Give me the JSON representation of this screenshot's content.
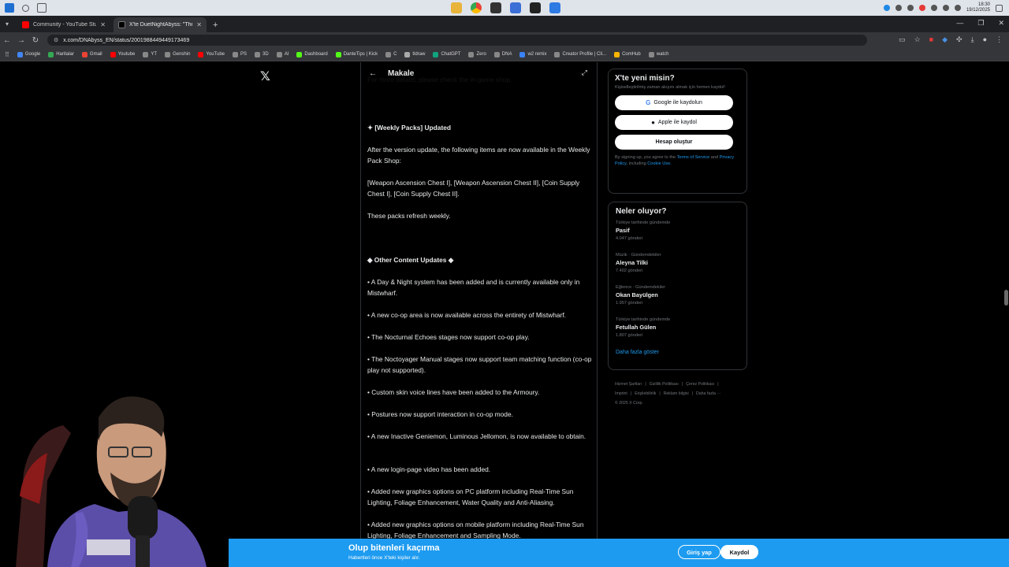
{
  "taskbar": {
    "clock_time": "18:30",
    "clock_date": "19/12/2025"
  },
  "browser": {
    "tabs": [
      {
        "title": "Community - YouTube Studio",
        "active": false,
        "color": "#ff0000"
      },
      {
        "title": "X'te DuetNightAbyss: \"The Wi",
        "active": true,
        "color": "#000000"
      }
    ],
    "url": "x.com/DNAbyss_EN/status/2001988449449173469",
    "bookmarks": [
      "Google",
      "Haritalar",
      "Gmail",
      "Youtube",
      "YT",
      "Genshin",
      "YouTube",
      "PS",
      "3D",
      "AI",
      "Dashboard",
      "DanteTips | Kick",
      "C",
      "tldraw",
      "ChatGPT",
      "Zero",
      "DNA",
      "w2 remix",
      "Creator Profile | Cli...",
      "ComHub",
      "watch"
    ]
  },
  "article": {
    "header_title": "Makale",
    "paragraphs": [
      {
        "text": "For more details, please check the in-game shop.",
        "bold": false
      },
      {
        "text": "✦ [Weekly Packs] Updated",
        "bold": true
      },
      {
        "text": "After the version update, the following items are now available in the Weekly Pack Shop:",
        "bold": false
      },
      {
        "text": "[Weapon Ascension Chest I], [Weapon Ascension Chest II], [Coin Supply Chest I], [Coin Supply Chest II].",
        "bold": false
      },
      {
        "text": "These packs refresh weekly.",
        "bold": false
      },
      {
        "text": "◆ Other Content Updates ◆",
        "bold": true
      },
      {
        "text": "• A Day & Night system has been added and is currently available only in Mistwharf.",
        "bold": false
      },
      {
        "text": "• A new co-op area is now available across the entirety of Mistwharf.",
        "bold": false
      },
      {
        "text": "• The Nocturnal Echoes stages now support co-op play.",
        "bold": false
      },
      {
        "text": "• The Noctoyager Manual stages now support team matching function (co-op play not supported).",
        "bold": false
      },
      {
        "text": "• Custom skin voice lines have been added to the Armoury.",
        "bold": false
      },
      {
        "text": "• Postures now support interaction in co-op mode.",
        "bold": false
      },
      {
        "text": "• A new Inactive Geniemon, Luminous Jellomon, is now available to obtain.",
        "bold": false
      },
      {
        "text": "• A new login-page video has been added.",
        "bold": false
      },
      {
        "text": "• Added new graphics options on PC platform including Real-Time Sun Lighting, Foliage Enhancement, Water Quality and Anti-Aliasing.",
        "bold": false
      },
      {
        "text": "• Added new graphics options on mobile platform including Real-Time Sun Lighting, Foliage Enhancement and Sampling Mode.",
        "bold": false
      }
    ]
  },
  "signup": {
    "title": "X'te yeni misin?",
    "subtitle": "Kişiselleştirilmiş zaman akışını almak için hemen kaydol!",
    "google_label": "Google ile kaydolun",
    "apple_label": "Apple ile kaydol",
    "create_label": "Hesap oluştur",
    "legal_prefix": "By signing up, you agree to the ",
    "terms": "Terms of Service",
    "and": " and ",
    "privacy": "Privacy Policy",
    "including": ", including ",
    "cookie": "Cookie Use."
  },
  "trends": {
    "title": "Neler oluyor?",
    "items": [
      {
        "context": "Türkiye tarihinde gündemde",
        "name": "Pasif",
        "count": "4.047 gönderi"
      },
      {
        "context": "Müzik · Gündemdekiler",
        "name": "Aleyna Tilki",
        "count": "7.402 gönderi"
      },
      {
        "context": "Eğlence · Gündemdekiler",
        "name": "Okan Bayülgen",
        "count": "1.957 gönderi"
      },
      {
        "context": "Türkiye tarihinde gündemde",
        "name": "Fetullah Gülen",
        "count": "1.807 gönderi"
      }
    ],
    "show_more": "Daha fazla göster"
  },
  "footer": {
    "links": [
      "Hizmet Şartları",
      "Gizlilik Politikası",
      "Çerez Politikası",
      "Imprint",
      "Erişilebilirlik",
      "Reklam bilgisi",
      "Daha fazla ···"
    ],
    "copyright": "© 2025 X Corp."
  },
  "banner": {
    "title": "Olup bitenleri kaçırma",
    "subtitle": "Habertleri önce X'teki kişiler alır.",
    "login_label": "Giriş yap",
    "signup_label": "Kaydol"
  },
  "colors": {
    "accent": "#1d9bf0",
    "background": "#000000",
    "border": "#2f3336"
  }
}
